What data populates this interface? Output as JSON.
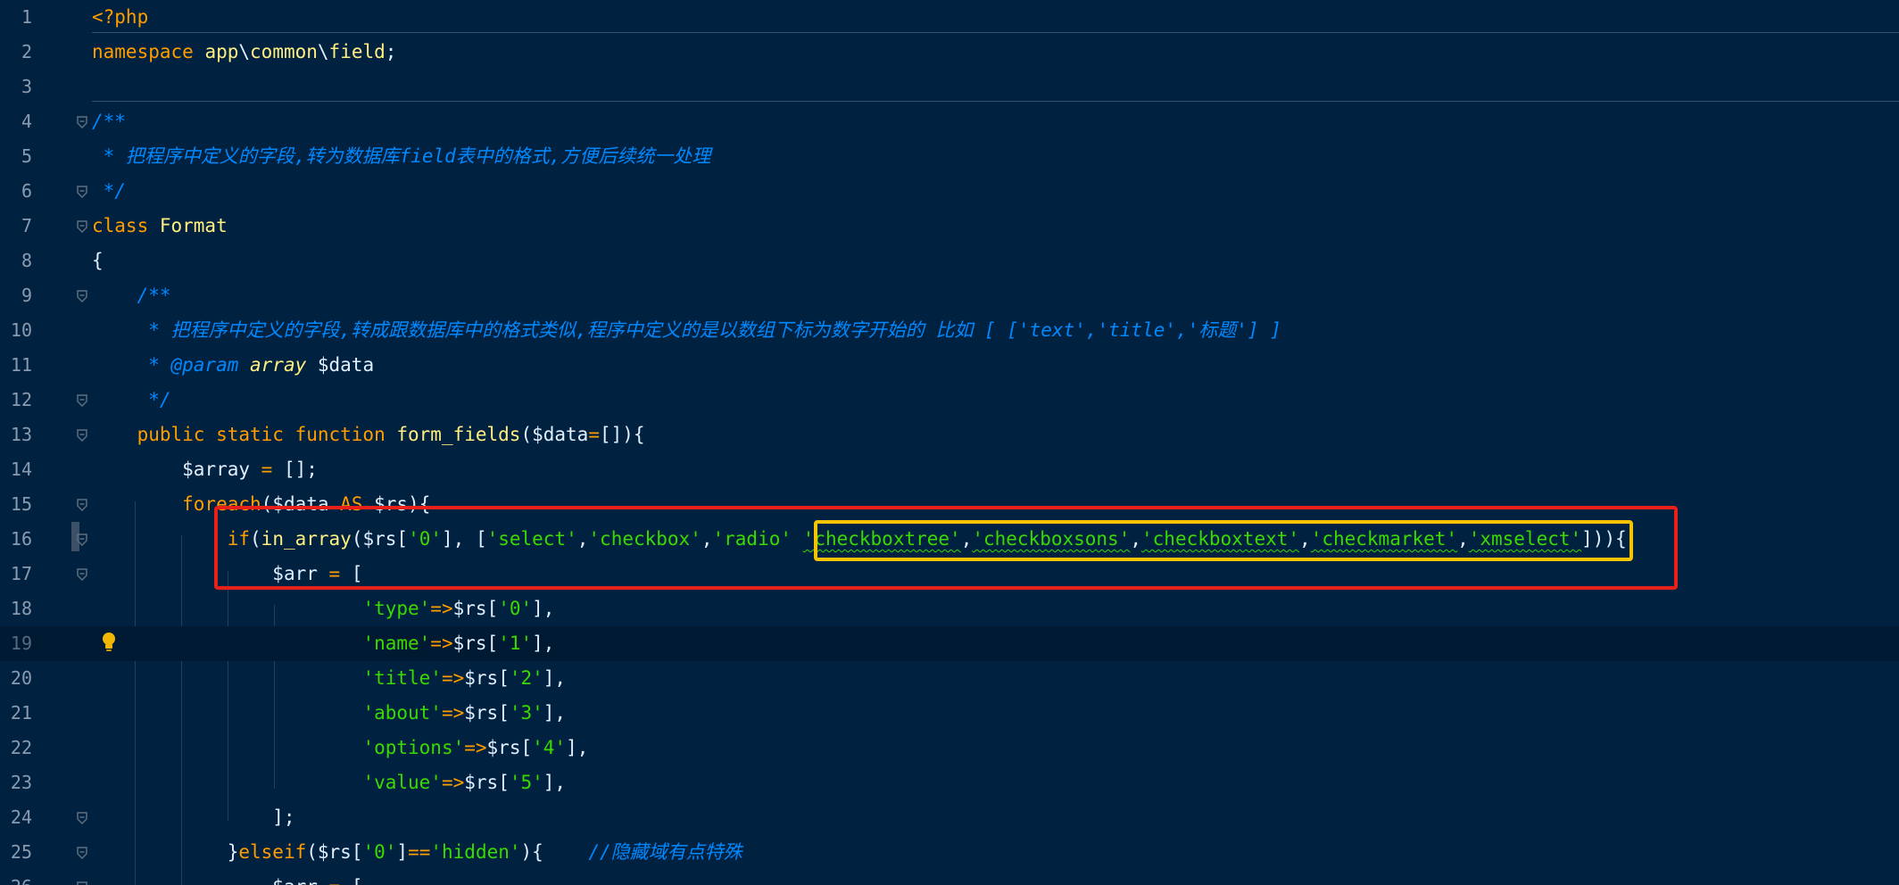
{
  "editor": {
    "language": "php",
    "current_line": 19,
    "colors": {
      "background": "#002240",
      "keyword": "#ff9d00",
      "string": "#3ad900",
      "comment": "#0088ff",
      "function": "#ffee80",
      "highlight_outer": "#e8201a",
      "highlight_inner": "#f5c400"
    },
    "icons": {
      "fold": "fold-marker-icon",
      "hint": "lightbulb-icon"
    },
    "lines": [
      {
        "n": "1",
        "tokens": [
          {
            "t": "<?php",
            "c": "kw"
          }
        ]
      },
      {
        "n": "2",
        "tokens": [
          {
            "t": "namespace ",
            "c": "kw"
          },
          {
            "t": "app",
            "c": "fn"
          },
          {
            "t": "\\",
            "c": "pu"
          },
          {
            "t": "common",
            "c": "fn"
          },
          {
            "t": "\\",
            "c": "pu"
          },
          {
            "t": "field",
            "c": "fn"
          },
          {
            "t": ";",
            "c": "pu"
          }
        ]
      },
      {
        "n": "3",
        "tokens": []
      },
      {
        "n": "4",
        "tokens": [
          {
            "t": "/**",
            "c": "cm"
          }
        ]
      },
      {
        "n": "5",
        "tokens": [
          {
            "t": " * 把程序中定义的字段,转为数据库field表中的格式,方便后续统一处理",
            "c": "cm"
          }
        ]
      },
      {
        "n": "6",
        "tokens": [
          {
            "t": " */",
            "c": "cm"
          }
        ]
      },
      {
        "n": "7",
        "tokens": [
          {
            "t": "class ",
            "c": "kw"
          },
          {
            "t": "Format",
            "c": "fn"
          }
        ]
      },
      {
        "n": "8",
        "tokens": [
          {
            "t": "{",
            "c": "pu"
          }
        ]
      },
      {
        "n": "9",
        "tokens": [
          {
            "t": "    /**",
            "c": "cm"
          }
        ]
      },
      {
        "n": "10",
        "tokens": [
          {
            "t": "     * 把程序中定义的字段,转成跟数据库中的格式类似,程序中定义的是以数组下标为数字开始的 比如 [ ['text','title','标题'] ]",
            "c": "cm"
          }
        ]
      },
      {
        "n": "11",
        "tokens": [
          {
            "t": "     * @param ",
            "c": "cm"
          },
          {
            "t": "array",
            "c": "ty"
          },
          {
            "t": " $data",
            "c": "va"
          }
        ]
      },
      {
        "n": "12",
        "tokens": [
          {
            "t": "     */",
            "c": "cm"
          }
        ]
      },
      {
        "n": "13",
        "tokens": [
          {
            "t": "    public static function ",
            "c": "kw"
          },
          {
            "t": "form_fields",
            "c": "fn"
          },
          {
            "t": "(",
            "c": "pu"
          },
          {
            "t": "$data",
            "c": "va"
          },
          {
            "t": "=",
            "c": "op"
          },
          {
            "t": "[]){",
            "c": "pu"
          }
        ]
      },
      {
        "n": "14",
        "tokens": [
          {
            "t": "        ",
            "c": "pu"
          },
          {
            "t": "$array",
            "c": "va"
          },
          {
            "t": " = ",
            "c": "op"
          },
          {
            "t": "[];",
            "c": "pu"
          }
        ]
      },
      {
        "n": "15",
        "tokens": [
          {
            "t": "        foreach",
            "c": "kw"
          },
          {
            "t": "(",
            "c": "pu"
          },
          {
            "t": "$data",
            "c": "va"
          },
          {
            "t": " AS ",
            "c": "kw"
          },
          {
            "t": "$rs",
            "c": "va"
          },
          {
            "t": "){",
            "c": "pu"
          }
        ]
      },
      {
        "n": "16",
        "tokens": [
          {
            "t": "            if",
            "c": "kw"
          },
          {
            "t": "(",
            "c": "pu"
          },
          {
            "t": "in_array",
            "c": "fn"
          },
          {
            "t": "(",
            "c": "pu"
          },
          {
            "t": "$rs",
            "c": "va"
          },
          {
            "t": "[",
            "c": "pu"
          },
          {
            "t": "'0'",
            "c": "st"
          },
          {
            "t": "], [",
            "c": "pu"
          },
          {
            "t": "'select'",
            "c": "st"
          },
          {
            "t": ",",
            "c": "pu"
          },
          {
            "t": "'checkbox'",
            "c": "st"
          },
          {
            "t": ",",
            "c": "pu"
          },
          {
            "t": "'radio'",
            "c": "st"
          },
          {
            "t": " ",
            "c": "pu"
          },
          {
            "t": "'checkboxtree'",
            "c": "st u"
          },
          {
            "t": ",",
            "c": "pu"
          },
          {
            "t": "'checkboxsons'",
            "c": "st u"
          },
          {
            "t": ",",
            "c": "pu"
          },
          {
            "t": "'checkboxtext'",
            "c": "st u"
          },
          {
            "t": ",",
            "c": "pu"
          },
          {
            "t": "'checkmarket'",
            "c": "st u"
          },
          {
            "t": ",",
            "c": "pu"
          },
          {
            "t": "'xmselect'",
            "c": "st u"
          },
          {
            "t": "])){",
            "c": "pu"
          }
        ]
      },
      {
        "n": "17",
        "tokens": [
          {
            "t": "                ",
            "c": "pu"
          },
          {
            "t": "$arr",
            "c": "va"
          },
          {
            "t": " = ",
            "c": "op"
          },
          {
            "t": "[",
            "c": "pu"
          }
        ]
      },
      {
        "n": "18",
        "tokens": [
          {
            "t": "                        ",
            "c": "pu"
          },
          {
            "t": "'type'",
            "c": "st"
          },
          {
            "t": "=>",
            "c": "op"
          },
          {
            "t": "$rs",
            "c": "va"
          },
          {
            "t": "[",
            "c": "pu"
          },
          {
            "t": "'0'",
            "c": "st"
          },
          {
            "t": "],",
            "c": "pu"
          }
        ]
      },
      {
        "n": "19",
        "tokens": [
          {
            "t": "                        ",
            "c": "pu"
          },
          {
            "t": "'name'",
            "c": "st"
          },
          {
            "t": "=>",
            "c": "op"
          },
          {
            "t": "$rs",
            "c": "va"
          },
          {
            "t": "[",
            "c": "pu"
          },
          {
            "t": "'1'",
            "c": "st"
          },
          {
            "t": "],",
            "c": "pu"
          }
        ]
      },
      {
        "n": "20",
        "tokens": [
          {
            "t": "                        ",
            "c": "pu"
          },
          {
            "t": "'title'",
            "c": "st"
          },
          {
            "t": "=>",
            "c": "op"
          },
          {
            "t": "$rs",
            "c": "va"
          },
          {
            "t": "[",
            "c": "pu"
          },
          {
            "t": "'2'",
            "c": "st"
          },
          {
            "t": "],",
            "c": "pu"
          }
        ]
      },
      {
        "n": "21",
        "tokens": [
          {
            "t": "                        ",
            "c": "pu"
          },
          {
            "t": "'about'",
            "c": "st"
          },
          {
            "t": "=>",
            "c": "op"
          },
          {
            "t": "$rs",
            "c": "va"
          },
          {
            "t": "[",
            "c": "pu"
          },
          {
            "t": "'3'",
            "c": "st"
          },
          {
            "t": "],",
            "c": "pu"
          }
        ]
      },
      {
        "n": "22",
        "tokens": [
          {
            "t": "                        ",
            "c": "pu"
          },
          {
            "t": "'options'",
            "c": "st"
          },
          {
            "t": "=>",
            "c": "op"
          },
          {
            "t": "$rs",
            "c": "va"
          },
          {
            "t": "[",
            "c": "pu"
          },
          {
            "t": "'4'",
            "c": "st"
          },
          {
            "t": "],",
            "c": "pu"
          }
        ]
      },
      {
        "n": "23",
        "tokens": [
          {
            "t": "                        ",
            "c": "pu"
          },
          {
            "t": "'value'",
            "c": "st"
          },
          {
            "t": "=>",
            "c": "op"
          },
          {
            "t": "$rs",
            "c": "va"
          },
          {
            "t": "[",
            "c": "pu"
          },
          {
            "t": "'5'",
            "c": "st"
          },
          {
            "t": "],",
            "c": "pu"
          }
        ]
      },
      {
        "n": "24",
        "tokens": [
          {
            "t": "                ];",
            "c": "pu"
          }
        ]
      },
      {
        "n": "25",
        "tokens": [
          {
            "t": "            }",
            "c": "pu"
          },
          {
            "t": "elseif",
            "c": "kw"
          },
          {
            "t": "(",
            "c": "pu"
          },
          {
            "t": "$rs",
            "c": "va"
          },
          {
            "t": "[",
            "c": "pu"
          },
          {
            "t": "'0'",
            "c": "st"
          },
          {
            "t": "]",
            "c": "pu"
          },
          {
            "t": "==",
            "c": "op"
          },
          {
            "t": "'hidden'",
            "c": "st"
          },
          {
            "t": "){    ",
            "c": "pu"
          },
          {
            "t": "//隐藏域有点特殊",
            "c": "cm"
          }
        ]
      },
      {
        "n": "26",
        "tokens": [
          {
            "t": "                ",
            "c": "pu"
          },
          {
            "t": "$arr",
            "c": "va"
          },
          {
            "t": " = ",
            "c": "op"
          },
          {
            "t": "[",
            "c": "pu"
          }
        ]
      }
    ]
  }
}
